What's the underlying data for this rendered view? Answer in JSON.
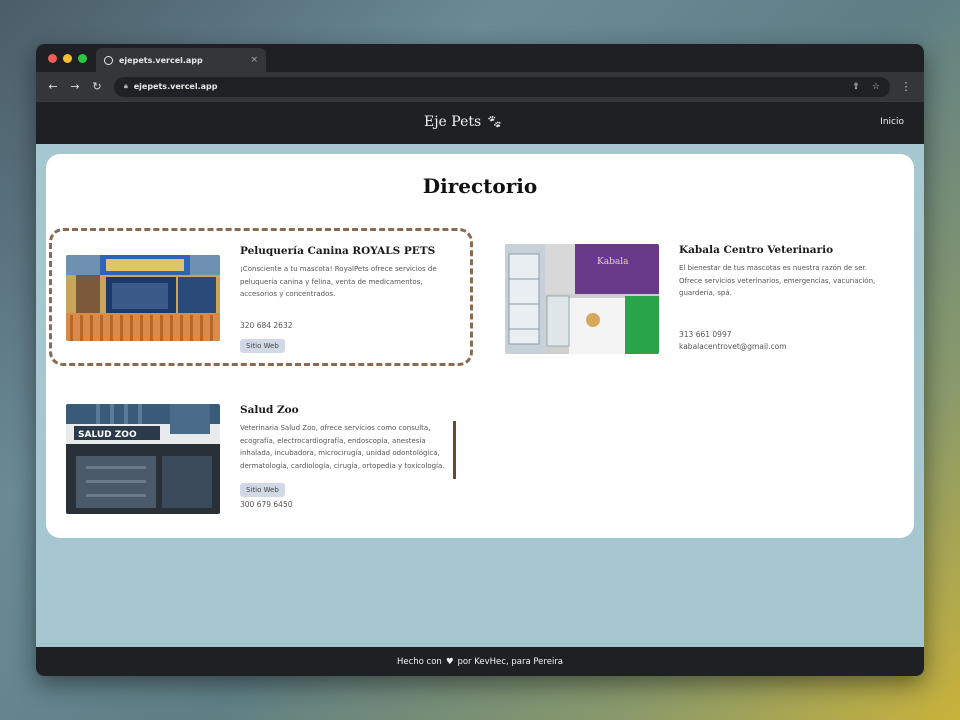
{
  "browser": {
    "tab_title": "ejepets.vercel.app",
    "tab_close": "×",
    "url": "ejepets.vercel.app"
  },
  "site": {
    "brand": "Eje Pets",
    "nav_home": "Inicio"
  },
  "page": {
    "title": "Directorio"
  },
  "directory": [
    {
      "name": "Peluquería Canina ROYALS PETS",
      "description": "¡Consciente a tu mascota! RoyalPets ofrece servicios de peluquería canina y felina, venta de medicamentos, accesorios y concentrados.",
      "phone": "320 684 2632",
      "button": "Sitio Web"
    },
    {
      "name": "Kabala Centro Veterinario",
      "description": "El bienestar de tus mascotas es nuestra razón de ser. Ofrece servicios veterinarios, emergencias, vacunación, guardería, spá.",
      "phone": "313 661 0997",
      "email": "kabalacentrovet@gmail.com",
      "sign": "Kabala"
    },
    {
      "name": "Salud Zoo",
      "description": "Veterinaria Salud Zoo, ofrece servicios como consulta, ecografía, electrocardiografía, endoscopia, anestesia inhalada, incubadora, microcirugía, unidad odontológica, dermatología, cardiología, cirugía, ortopedia y toxicología.",
      "phone": "300 679 6450",
      "button": "Sitio Web",
      "sign": "SALUD ZOO"
    }
  ],
  "footer": {
    "prefix": "Hecho con",
    "suffix": "por KevHec, para Pereira"
  },
  "colors": {
    "highlight_border": "#8a6a50",
    "dark_bar": "#1f2023",
    "page_bg": "#a6c7cf"
  }
}
